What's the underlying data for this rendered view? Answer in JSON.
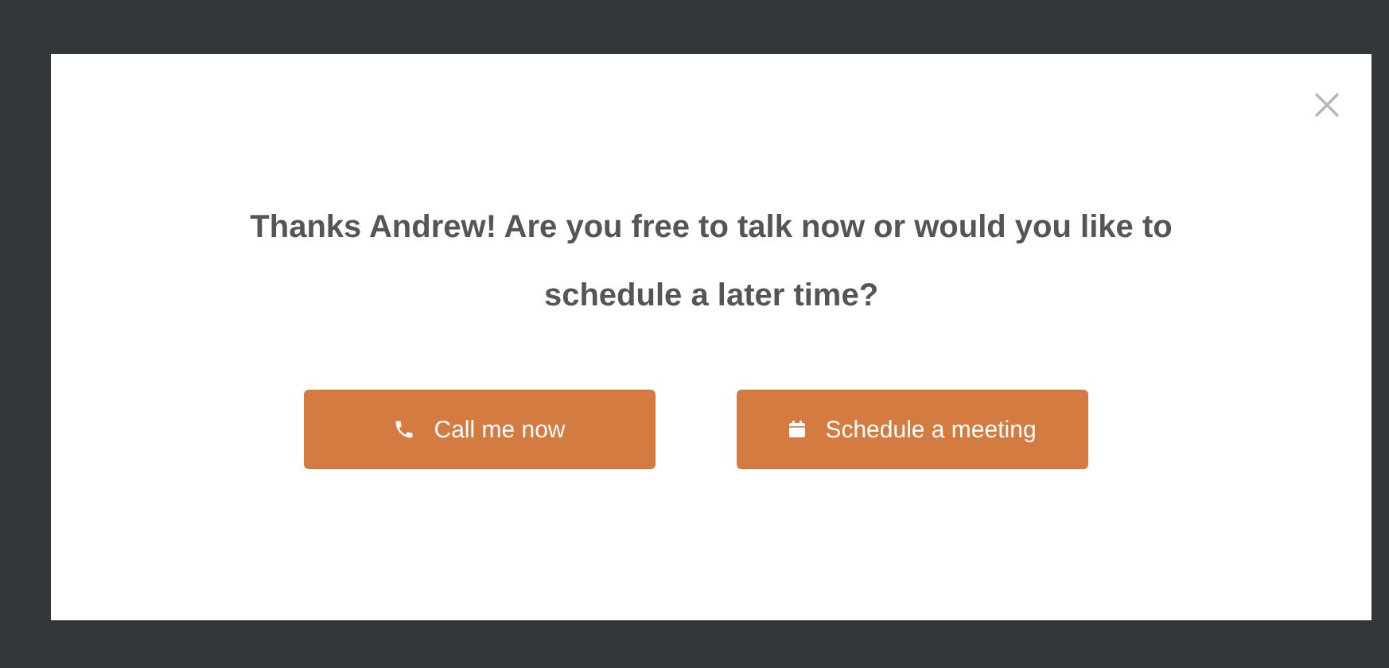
{
  "dialog": {
    "message": "Thanks Andrew! Are you free to talk now or would you like to schedule a later time?",
    "buttons": [
      {
        "label": "Call me now",
        "kind": "phone"
      },
      {
        "label": "Schedule a meeting",
        "kind": "calendar"
      }
    ]
  }
}
